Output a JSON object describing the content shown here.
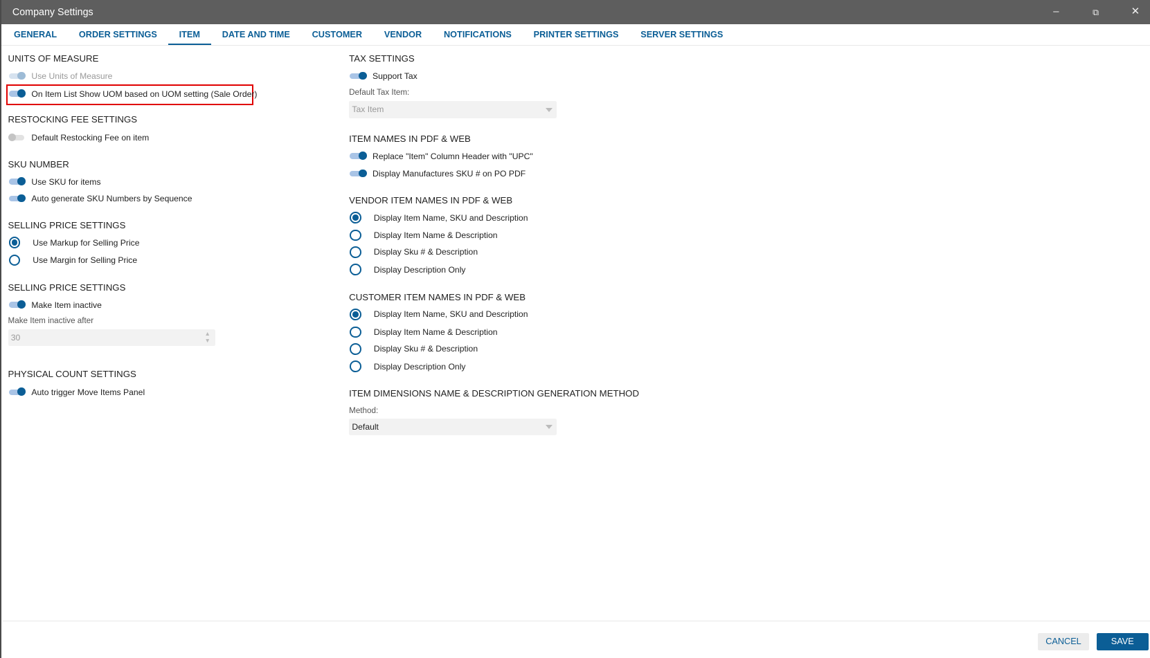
{
  "window": {
    "title": "Company Settings",
    "minimize_icon": "minimize-icon",
    "restore_icon": "restore-icon",
    "close_icon": "close-icon"
  },
  "tabs": [
    "GENERAL",
    "ORDER SETTINGS",
    "ITEM",
    "DATE AND TIME",
    "CUSTOMER",
    "VENDOR",
    "NOTIFICATIONS",
    "PRINTER SETTINGS",
    "SERVER SETTINGS"
  ],
  "active_tab": "ITEM",
  "left": {
    "uom": {
      "header": "UNITS OF MEASURE",
      "use_uom": "Use Units of Measure",
      "show_uom": "On Item List Show UOM based on UOM setting (Sale Order)"
    },
    "restock": {
      "header": "RESTOCKING FEE SETTINGS",
      "default_fee": "Default Restocking Fee on item"
    },
    "sku": {
      "header": "SKU NUMBER",
      "use_sku": "Use SKU for items",
      "auto_sku": "Auto generate SKU Numbers by Sequence"
    },
    "selling": {
      "header": "SELLING PRICE SETTINGS",
      "markup": "Use Markup for Selling Price",
      "margin": "Use Margin for Selling Price"
    },
    "inactive": {
      "header": "SELLING PRICE SETTINGS",
      "make_inactive": "Make Item inactive",
      "after_label": "Make Item inactive after",
      "after_value": "30"
    },
    "physical": {
      "header": "PHYSICAL COUNT SETTINGS",
      "auto_trigger": "Auto trigger Move Items Panel"
    }
  },
  "right": {
    "tax": {
      "header": "TAX SETTINGS",
      "support_tax": "Support Tax",
      "default_label": "Default Tax Item:",
      "default_placeholder": "Tax Item"
    },
    "item_names": {
      "header": "ITEM NAMES IN PDF & WEB",
      "replace_upc": "Replace \"Item\" Column Header with \"UPC\"",
      "manuf_sku": "Display Manufactures SKU # on PO PDF"
    },
    "vendor_names": {
      "header": "VENDOR ITEM NAMES IN PDF & WEB",
      "options": [
        "Display Item Name, SKU and Description",
        "Display Item Name & Description",
        "Display Sku # & Description",
        "Display Description Only"
      ],
      "selected": 0
    },
    "customer_names": {
      "header": "CUSTOMER ITEM NAMES IN PDF & WEB",
      "options": [
        "Display Item Name, SKU and Description",
        "Display Item Name & Description",
        "Display Sku # & Description",
        "Display Description Only"
      ],
      "selected": 0
    },
    "dimensions": {
      "header": "ITEM DIMENSIONS NAME & DESCRIPTION GENERATION METHOD",
      "method_label": "Method:",
      "method_value": "Default"
    }
  },
  "footer": {
    "cancel": "CANCEL",
    "save": "SAVE"
  },
  "colors": {
    "accent": "#0b5e96",
    "highlight": "#e00000"
  }
}
